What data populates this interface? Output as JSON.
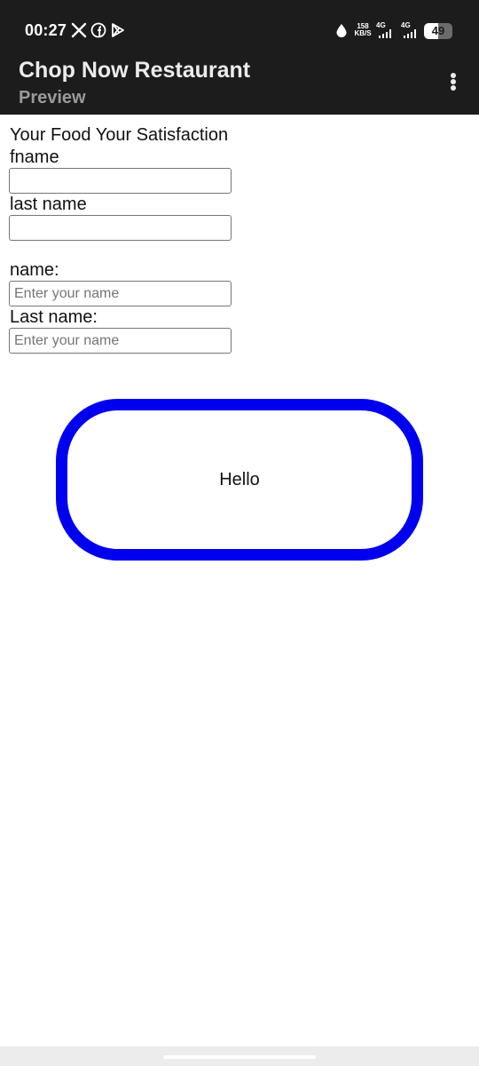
{
  "status_bar": {
    "time": "00:27",
    "notification_icons": [
      "x-icon",
      "facebook-icon",
      "play-store-icon"
    ],
    "data_saver_icon": "drop-icon",
    "speed_value": "158",
    "speed_unit": "KB/S",
    "network_1": "4G",
    "network_2": "4G",
    "battery_level": "49"
  },
  "app_bar": {
    "title": "Chop Now Restaurant",
    "subtitle": "Preview",
    "menu_icon": "more-vert-icon"
  },
  "form": {
    "heading": "Your Food Your Satisfaction",
    "fname_label": "fname",
    "fname_value": "",
    "lname_label": "last name",
    "lname_value": "",
    "name_label": "name:",
    "name_placeholder": "Enter your name",
    "last_name_label": "Last name:",
    "last_name_placeholder": "Enter your name"
  },
  "hello_button": {
    "label": "Hello",
    "border_color": "#0000ee"
  },
  "colors": {
    "app_bar_bg": "#1c1c1c",
    "title_text": "#ececec",
    "subtitle_text": "#9a9a9a"
  }
}
